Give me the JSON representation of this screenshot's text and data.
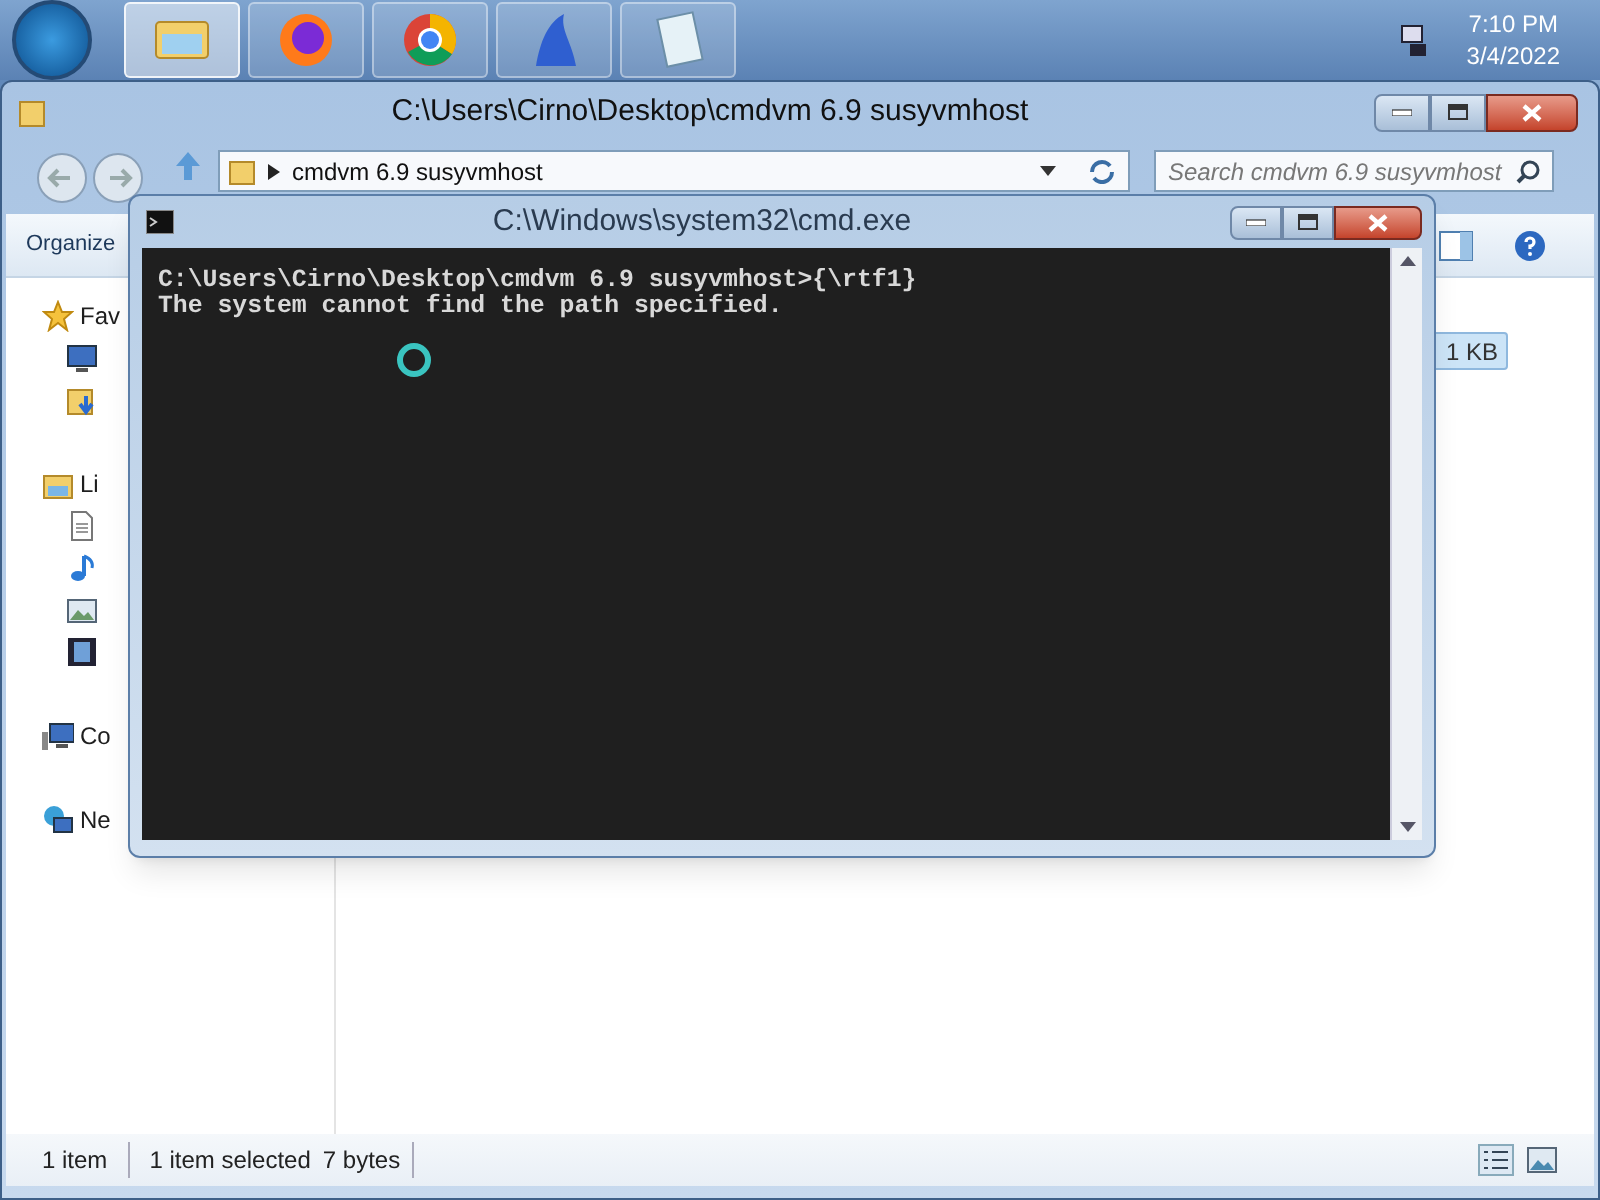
{
  "taskbar": {
    "apps": [
      {
        "kind": "explorer",
        "selected": true
      },
      {
        "kind": "firefox",
        "selected": false
      },
      {
        "kind": "chrome",
        "selected": false
      },
      {
        "kind": "bluefin",
        "selected": false
      },
      {
        "kind": "notepad",
        "selected": false
      }
    ],
    "clock": {
      "time": "7:10 PM",
      "date": "3/4/2022"
    }
  },
  "explorer": {
    "title": "C:\\Users\\Cirno\\Desktop\\cmdvm 6.9 susyvmhost",
    "address": "cmdvm 6.9 susyvmhost",
    "search": {
      "placeholder": "Search cmdvm 6.9 susyvmhost"
    },
    "toolbar": {
      "organize": "Organize"
    },
    "sidebar": [
      {
        "kind": "star",
        "label": "Fav",
        "children": [
          {
            "kind": "desktop"
          },
          {
            "kind": "download"
          }
        ]
      },
      {
        "kind": "library",
        "label": "Li",
        "children": [
          {
            "kind": "document"
          },
          {
            "kind": "music"
          },
          {
            "kind": "picture"
          },
          {
            "kind": "video"
          }
        ]
      },
      {
        "kind": "computer",
        "label": "Co"
      },
      {
        "kind": "network",
        "label": "Ne"
      }
    ],
    "file": {
      "size": "1 KB",
      "selected": true
    },
    "status": [
      "1 item",
      "1 item selected",
      "7 bytes"
    ]
  },
  "cmd": {
    "title": "C:\\Windows\\system32\\cmd.exe",
    "lines": [
      "C:\\Users\\Cirno\\Desktop\\cmdvm 6.9 susyvmhost>{\\rtf1}",
      "The system cannot find the path specified."
    ]
  }
}
